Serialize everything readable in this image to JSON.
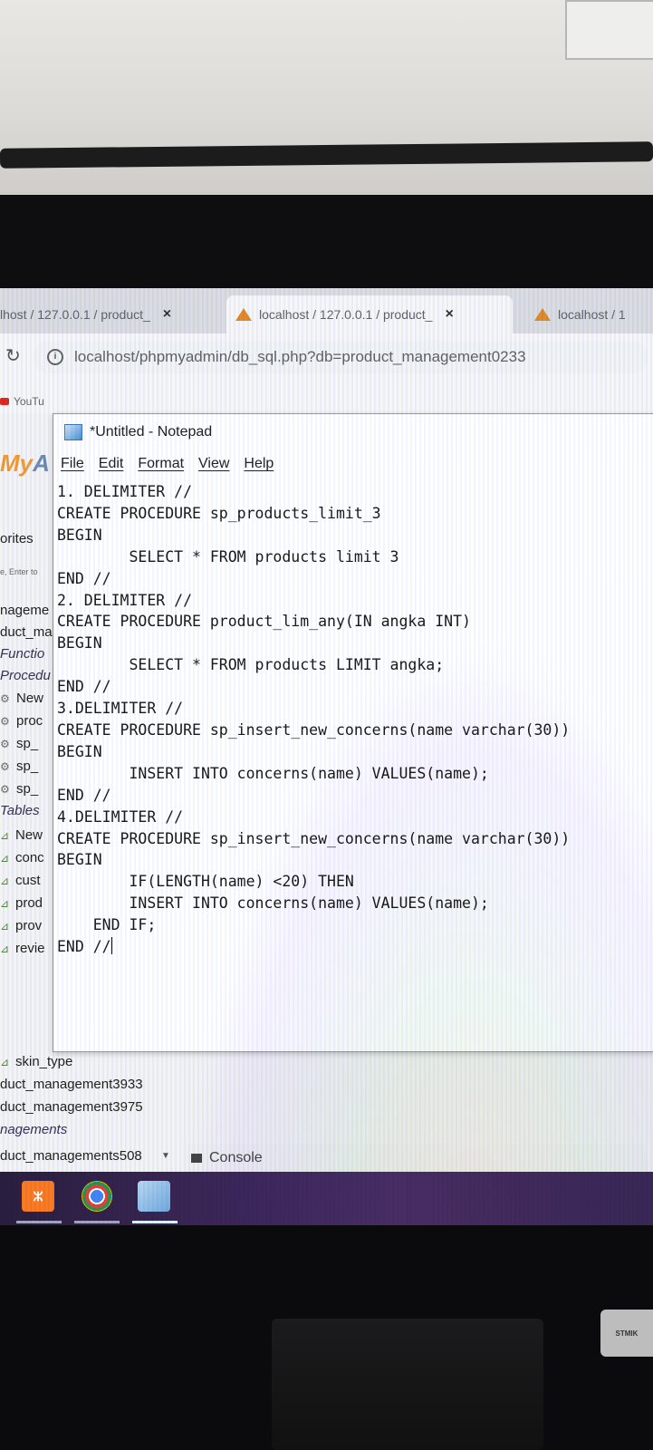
{
  "browser": {
    "tabs": [
      {
        "label": "lhost / 127.0.0.1 / product_",
        "close": "×",
        "active": false
      },
      {
        "label": "localhost / 127.0.0.1 / product_",
        "close": "×",
        "active": true
      },
      {
        "label": "localhost / 1",
        "active": false
      }
    ],
    "url": "localhost/phpmyadmin/db_sql.php?db=product_management0233",
    "bookmarks": [
      "YouTu"
    ]
  },
  "phpmyadmin": {
    "logo_part1": "My",
    "logo_part2": "A",
    "favorites": "orites",
    "filter_placeholder": "e, Enter to",
    "items": [
      {
        "label": "nageme",
        "style": "plain"
      },
      {
        "label": "duct_ma",
        "style": "plain"
      },
      {
        "label": "Functio",
        "style": "italic"
      },
      {
        "label": "Procedu",
        "style": "italic"
      },
      {
        "label": "New",
        "style": "proc"
      },
      {
        "label": "proc",
        "style": "proc"
      },
      {
        "label": "sp_",
        "style": "proc"
      },
      {
        "label": "sp_",
        "style": "proc"
      },
      {
        "label": "sp_",
        "style": "proc"
      },
      {
        "label": "Tables",
        "style": "italic"
      },
      {
        "label": "New",
        "style": "table"
      },
      {
        "label": "conc",
        "style": "table"
      },
      {
        "label": "cust",
        "style": "table"
      },
      {
        "label": "prod",
        "style": "table"
      },
      {
        "label": "prov",
        "style": "table"
      },
      {
        "label": "revie",
        "style": "table"
      },
      {
        "label": "skin_type",
        "style": "table"
      },
      {
        "label": "duct_management3933",
        "style": "plain"
      },
      {
        "label": "duct_management3975",
        "style": "plain"
      },
      {
        "label": "nagements",
        "style": "italic"
      },
      {
        "label": "duct_managements508",
        "style": "plain"
      }
    ],
    "console_label": "Console"
  },
  "notepad": {
    "title": "*Untitled - Notepad",
    "menu": [
      "File",
      "Edit",
      "Format",
      "View",
      "Help"
    ],
    "lines": [
      "1. DELIMITER //",
      "CREATE PROCEDURE sp_products_limit_3",
      "BEGIN",
      "        SELECT * FROM products limit 3",
      "END //",
      "2. DELIMITER //",
      "CREATE PROCEDURE product_lim_any(IN angka INT)",
      "BEGIN",
      "        SELECT * FROM products LIMIT angka;",
      "END //",
      "3.DELIMITER //",
      "CREATE PROCEDURE sp_insert_new_concerns(name varchar(30))",
      "BEGIN",
      "        INSERT INTO concerns(name) VALUES(name);",
      "END //",
      "4.DELIMITER //",
      "CREATE PROCEDURE sp_insert_new_concerns(name varchar(30))",
      "BEGIN",
      "        IF(LENGTH(name) <20) THEN",
      "        INSERT INTO concerns(name) VALUES(name);",
      "    END IF;",
      "END //"
    ]
  },
  "taskbar": {
    "apps": [
      "xampp",
      "chrome",
      "notepad"
    ]
  },
  "sticker_text": "STMIK"
}
